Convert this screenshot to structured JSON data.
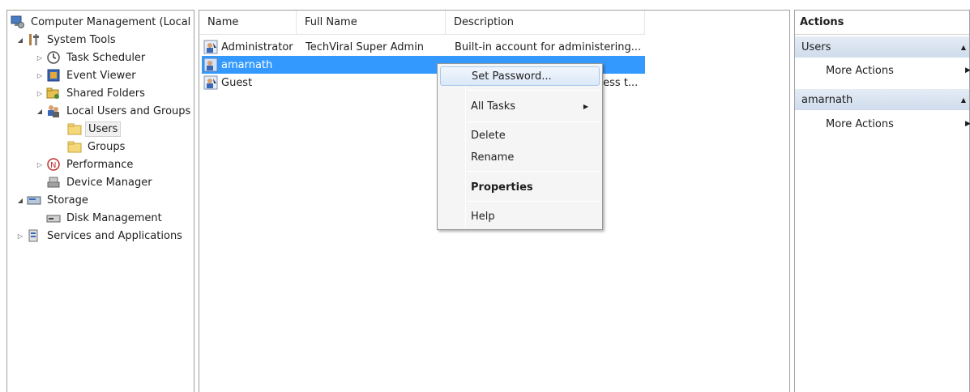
{
  "tree": {
    "root": "Computer Management (Local",
    "system_tools": "System Tools",
    "task_scheduler": "Task Scheduler",
    "event_viewer": "Event Viewer",
    "shared_folders": "Shared Folders",
    "local_users_groups": "Local Users and Groups",
    "users": "Users",
    "groups": "Groups",
    "performance": "Performance",
    "device_manager": "Device Manager",
    "storage": "Storage",
    "disk_management": "Disk Management",
    "services_apps": "Services and Applications"
  },
  "list": {
    "columns": [
      "Name",
      "Full Name",
      "Description"
    ],
    "rows": [
      {
        "name": "Administrator",
        "full_name": "TechViral Super Admin",
        "description": "Built-in account for administering..."
      },
      {
        "name": "amarnath",
        "full_name": "",
        "description": ""
      },
      {
        "name": "Guest",
        "full_name": "",
        "description": "cess t..."
      }
    ]
  },
  "context_menu": {
    "set_password": "Set Password...",
    "all_tasks": "All Tasks",
    "delete": "Delete",
    "rename": "Rename",
    "properties": "Properties",
    "help": "Help"
  },
  "actions": {
    "title": "Actions",
    "section1": "Users",
    "section1_more": "More Actions",
    "section2": "amarnath",
    "section2_more": "More Actions"
  },
  "colors": {
    "selection": "#3399ff",
    "section_bg": "#cfdcec"
  }
}
